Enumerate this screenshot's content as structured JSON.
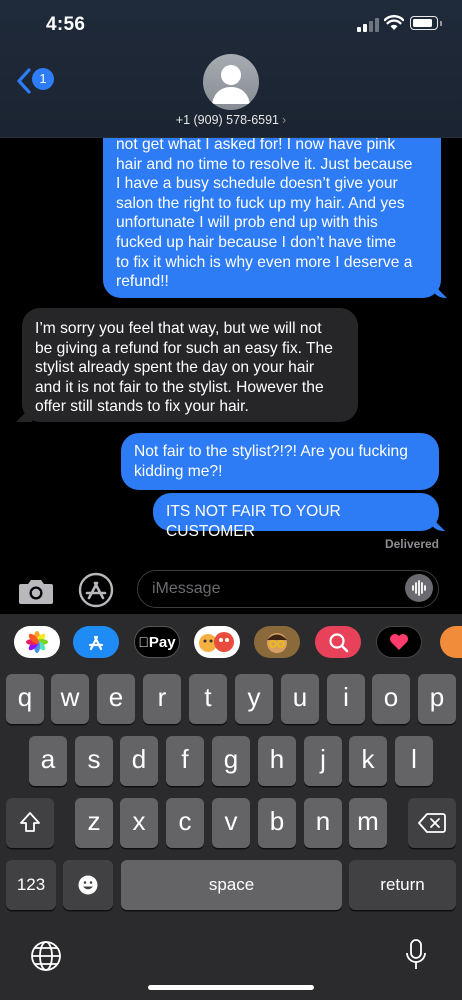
{
  "status": {
    "time": "4:56"
  },
  "header": {
    "back_count": "1",
    "phone": "+1 (909) 578-6591",
    "chevron": "›"
  },
  "messages": [
    {
      "dir": "sent",
      "lines": [
        "not get what I asked for! I now have pink",
        "hair and no time to resolve it. Just because",
        "I have a busy schedule doesn’t give your",
        "salon the right to fuck up my hair. And yes",
        "unfortunate I will prob end up with this",
        "fucked up hair because I don’t have time",
        "to fix it which is why even more I deserve a",
        "refund!!"
      ]
    },
    {
      "dir": "received",
      "lines": [
        "I’m sorry you feel that way, but we will not",
        "be giving a refund for such an easy fix. The",
        "stylist already spent the day on your hair",
        "and it is not fair to the stylist. However the",
        "offer still stands to fix your hair."
      ]
    },
    {
      "dir": "sent",
      "lines": [
        "Not fair to the stylist?!?! Are you fucking",
        "kidding me?!"
      ]
    },
    {
      "dir": "sent",
      "lines": [
        "ITS NOT FAIR TO YOUR CUSTOMER"
      ]
    }
  ],
  "delivered": "Delivered",
  "input": {
    "placeholder": "iMessage"
  },
  "app_strip": {
    "apple_pay": "Pay"
  },
  "keyboard": {
    "row1": [
      "q",
      "w",
      "e",
      "r",
      "t",
      "y",
      "u",
      "i",
      "o",
      "p"
    ],
    "row2": [
      "a",
      "s",
      "d",
      "f",
      "g",
      "h",
      "j",
      "k",
      "l"
    ],
    "row3": [
      "z",
      "x",
      "c",
      "v",
      "b",
      "n",
      "m"
    ],
    "numbers": "123",
    "space": "space",
    "return": "return"
  },
  "colors": {
    "sent_bubble": "#2d7cf6",
    "received_bubble": "#262628",
    "keyboard_bg": "#2b2b2d"
  }
}
